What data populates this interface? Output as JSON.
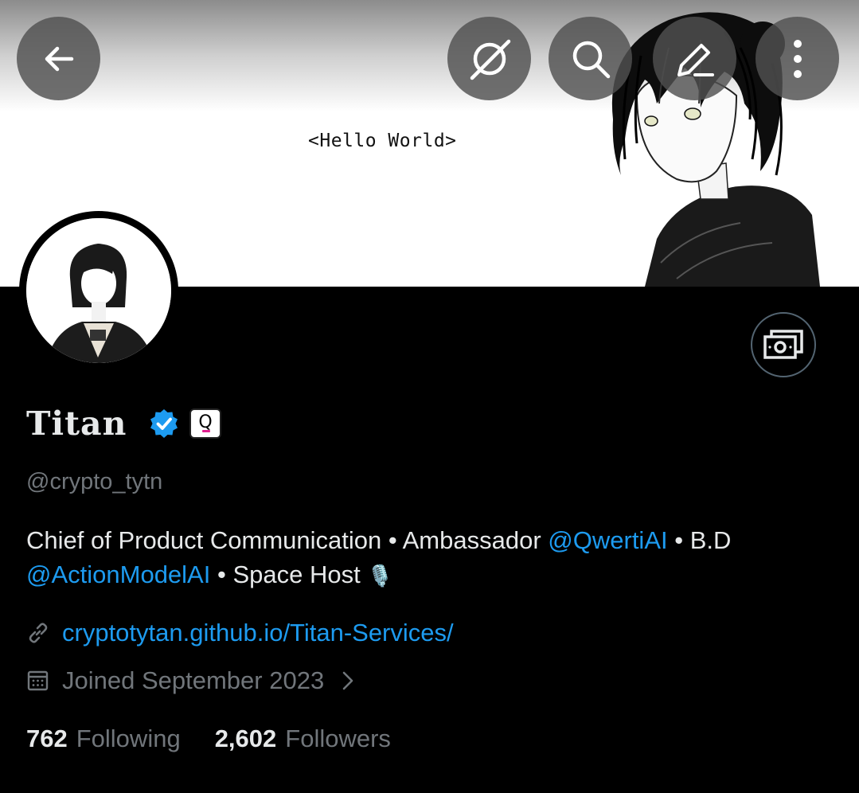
{
  "header": {
    "banner_text": "<Hello World>",
    "back_icon": "arrow-left-icon",
    "grok_icon": "grok-icon",
    "search_icon": "search-icon",
    "edit_icon": "edit-icon",
    "more_icon": "more-vertical-icon"
  },
  "profile": {
    "name": "Titan",
    "verified_icon": "verified-badge-icon",
    "affiliate_badge": "Q",
    "handle": "@crypto_tytn",
    "bio": {
      "part1": "Chief of Product Communication • Ambassador ",
      "mention1": "@QwertiAI",
      "part2": " • B.D",
      "mention2": "@ActionModelAI",
      "part3": " • Space Host",
      "emoji": "🎙️"
    },
    "website": "cryptotytan.github.io/Titan-Services/",
    "joined": "Joined September 2023",
    "following_count": "762",
    "following_label": "Following",
    "followers_count": "2,602",
    "followers_label": "Followers"
  },
  "colors": {
    "background": "#000000",
    "accent": "#1d9bf0",
    "secondary_text": "#71767b",
    "primary_text": "#e7e9ea"
  }
}
